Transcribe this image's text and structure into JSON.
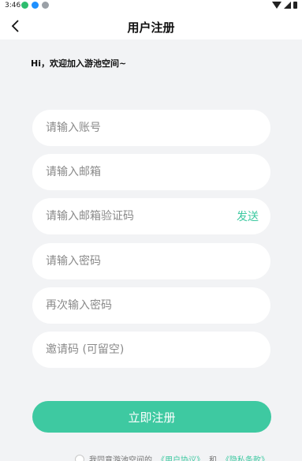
{
  "status": {
    "time": "3:46"
  },
  "header": {
    "title": "用户注册"
  },
  "welcome": "Hi，欢迎加入游池空间~",
  "fields": {
    "account": {
      "placeholder": "请输入账号"
    },
    "email": {
      "placeholder": "请输入邮箱"
    },
    "email_code": {
      "placeholder": "请输入邮箱验证码",
      "action": "发送"
    },
    "password": {
      "placeholder": "请输入密码"
    },
    "password_confirm": {
      "placeholder": "再次输入密码"
    },
    "invite": {
      "placeholder": "邀请码 (可留空)"
    }
  },
  "register": {
    "label": "立即注册"
  },
  "agreement": {
    "prefix": "我同意游池空间的",
    "user_agreement": "《用户协议》",
    "and": "和",
    "privacy": "《隐私条款》"
  },
  "colors": {
    "accent": "#3ec9a1",
    "background": "#f2f3f5"
  }
}
